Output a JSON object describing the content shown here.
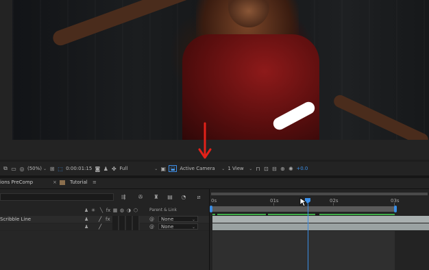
{
  "viewer": {
    "zoom": "(50%)",
    "timecode": "0:00:01:15",
    "resolution": "Full",
    "camera": "Active Camera",
    "view_layout": "1 View",
    "exposure": "+0.0"
  },
  "tabs": {
    "left_tab": "ions PreComp",
    "active_tab": "Tutorial"
  },
  "timeline_header": {
    "parent_link": "Parent & Link"
  },
  "layers": [
    {
      "name": "Scribble Line",
      "parent": "None"
    },
    {
      "name": "",
      "parent": "None"
    }
  ],
  "ruler": {
    "labels": [
      "0s",
      "01s",
      "02s",
      "03s"
    ],
    "current_time_fraction": 0.45
  },
  "colors": {
    "accent": "#3a8ee6",
    "annotation_arrow": "#e32119",
    "layer_bar": "#a9b0b0",
    "keyframe_line": "#3fae4a"
  }
}
